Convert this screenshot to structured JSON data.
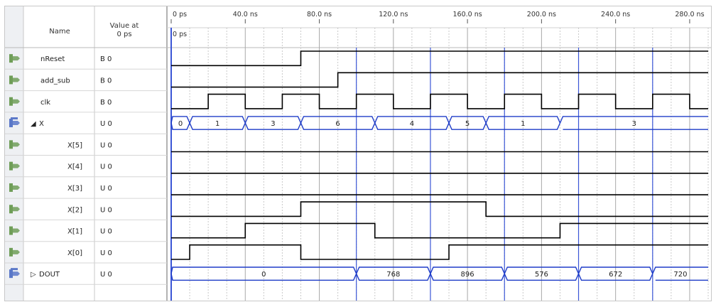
{
  "header": {
    "name_label": "Name",
    "value_label_line1": "Value at",
    "value_label_line2": "0 ps",
    "cursor_label": "0 ps"
  },
  "time_axis": {
    "unit": "ns",
    "range": [
      0,
      290
    ],
    "ticks": [
      {
        "t": 0,
        "label": "0 ps"
      },
      {
        "t": 40,
        "label": "40.0 ns"
      },
      {
        "t": 80,
        "label": "80.0 ns"
      },
      {
        "t": 120,
        "label": "120.0 ns"
      },
      {
        "t": 160,
        "label": "160.0 ns"
      },
      {
        "t": 200,
        "label": "200.0 ns"
      },
      {
        "t": 240,
        "label": "240.0 ns"
      },
      {
        "t": 280,
        "label": "280.0 ns"
      }
    ],
    "markers": [
      0,
      100,
      140,
      180,
      220,
      260
    ]
  },
  "signals": [
    {
      "name": "nReset",
      "value": "B 0",
      "icon": "input-pin-icon",
      "indent": 0,
      "expand": "",
      "kind": "bit",
      "init": 0,
      "events": [
        [
          70,
          1
        ]
      ]
    },
    {
      "name": "add_sub",
      "value": "B 0",
      "icon": "input-pin-icon",
      "indent": 0,
      "expand": "",
      "kind": "bit",
      "init": 0,
      "events": [
        [
          90,
          1
        ]
      ]
    },
    {
      "name": "clk",
      "value": "B 0",
      "icon": "input-pin-icon",
      "indent": 0,
      "expand": "",
      "kind": "bit",
      "init": 0,
      "events": [
        [
          20,
          1
        ],
        [
          40,
          0
        ],
        [
          60,
          1
        ],
        [
          80,
          0
        ],
        [
          100,
          1
        ],
        [
          120,
          0
        ],
        [
          140,
          1
        ],
        [
          160,
          0
        ],
        [
          180,
          1
        ],
        [
          200,
          0
        ],
        [
          220,
          1
        ],
        [
          240,
          0
        ],
        [
          260,
          1
        ],
        [
          280,
          0
        ]
      ]
    },
    {
      "name": "X",
      "value": "U 0",
      "icon": "input-bus-icon",
      "indent": 0,
      "expand": "◢",
      "kind": "bus",
      "segments": [
        [
          0,
          10,
          "0"
        ],
        [
          10,
          40,
          "1"
        ],
        [
          40,
          70,
          "3"
        ],
        [
          70,
          110,
          "6"
        ],
        [
          110,
          150,
          "4"
        ],
        [
          150,
          170,
          "5"
        ],
        [
          170,
          210,
          "1"
        ],
        [
          210,
          290,
          "3"
        ]
      ]
    },
    {
      "name": "X[5]",
      "value": "U 0",
      "icon": "input-pin-icon",
      "indent": 1,
      "expand": "",
      "kind": "bit",
      "init": 0,
      "events": []
    },
    {
      "name": "X[4]",
      "value": "U 0",
      "icon": "input-pin-icon",
      "indent": 1,
      "expand": "",
      "kind": "bit",
      "init": 0,
      "events": []
    },
    {
      "name": "X[3]",
      "value": "U 0",
      "icon": "input-pin-icon",
      "indent": 1,
      "expand": "",
      "kind": "bit",
      "init": 0,
      "events": []
    },
    {
      "name": "X[2]",
      "value": "U 0",
      "icon": "input-pin-icon",
      "indent": 1,
      "expand": "",
      "kind": "bit",
      "init": 0,
      "events": [
        [
          70,
          1
        ],
        [
          170,
          0
        ]
      ]
    },
    {
      "name": "X[1]",
      "value": "U 0",
      "icon": "input-pin-icon",
      "indent": 1,
      "expand": "",
      "kind": "bit",
      "init": 0,
      "events": [
        [
          40,
          1
        ],
        [
          110,
          0
        ],
        [
          210,
          1
        ]
      ]
    },
    {
      "name": "X[0]",
      "value": "U 0",
      "icon": "input-pin-icon",
      "indent": 1,
      "expand": "",
      "kind": "bit",
      "init": 0,
      "events": [
        [
          10,
          1
        ],
        [
          70,
          0
        ],
        [
          150,
          1
        ]
      ]
    },
    {
      "name": "DOUT",
      "value": "U 0",
      "icon": "output-bus-icon",
      "indent": 0,
      "expand": "▷",
      "kind": "bus",
      "segments": [
        [
          0,
          100,
          "0"
        ],
        [
          100,
          140,
          "768"
        ],
        [
          140,
          180,
          "896"
        ],
        [
          180,
          220,
          "576"
        ],
        [
          220,
          260,
          "672"
        ],
        [
          260,
          290,
          "720"
        ]
      ]
    }
  ],
  "colors": {
    "wave": "#000000",
    "bus_outline": "#1e3cc8",
    "marker": "#3b56d6",
    "grid": "#c9c9c9",
    "grid_major": "#a8a8a8",
    "row_line": "#d6d6d6",
    "icon_green": "#6f9e58",
    "icon_blue": "#5a78c8"
  }
}
